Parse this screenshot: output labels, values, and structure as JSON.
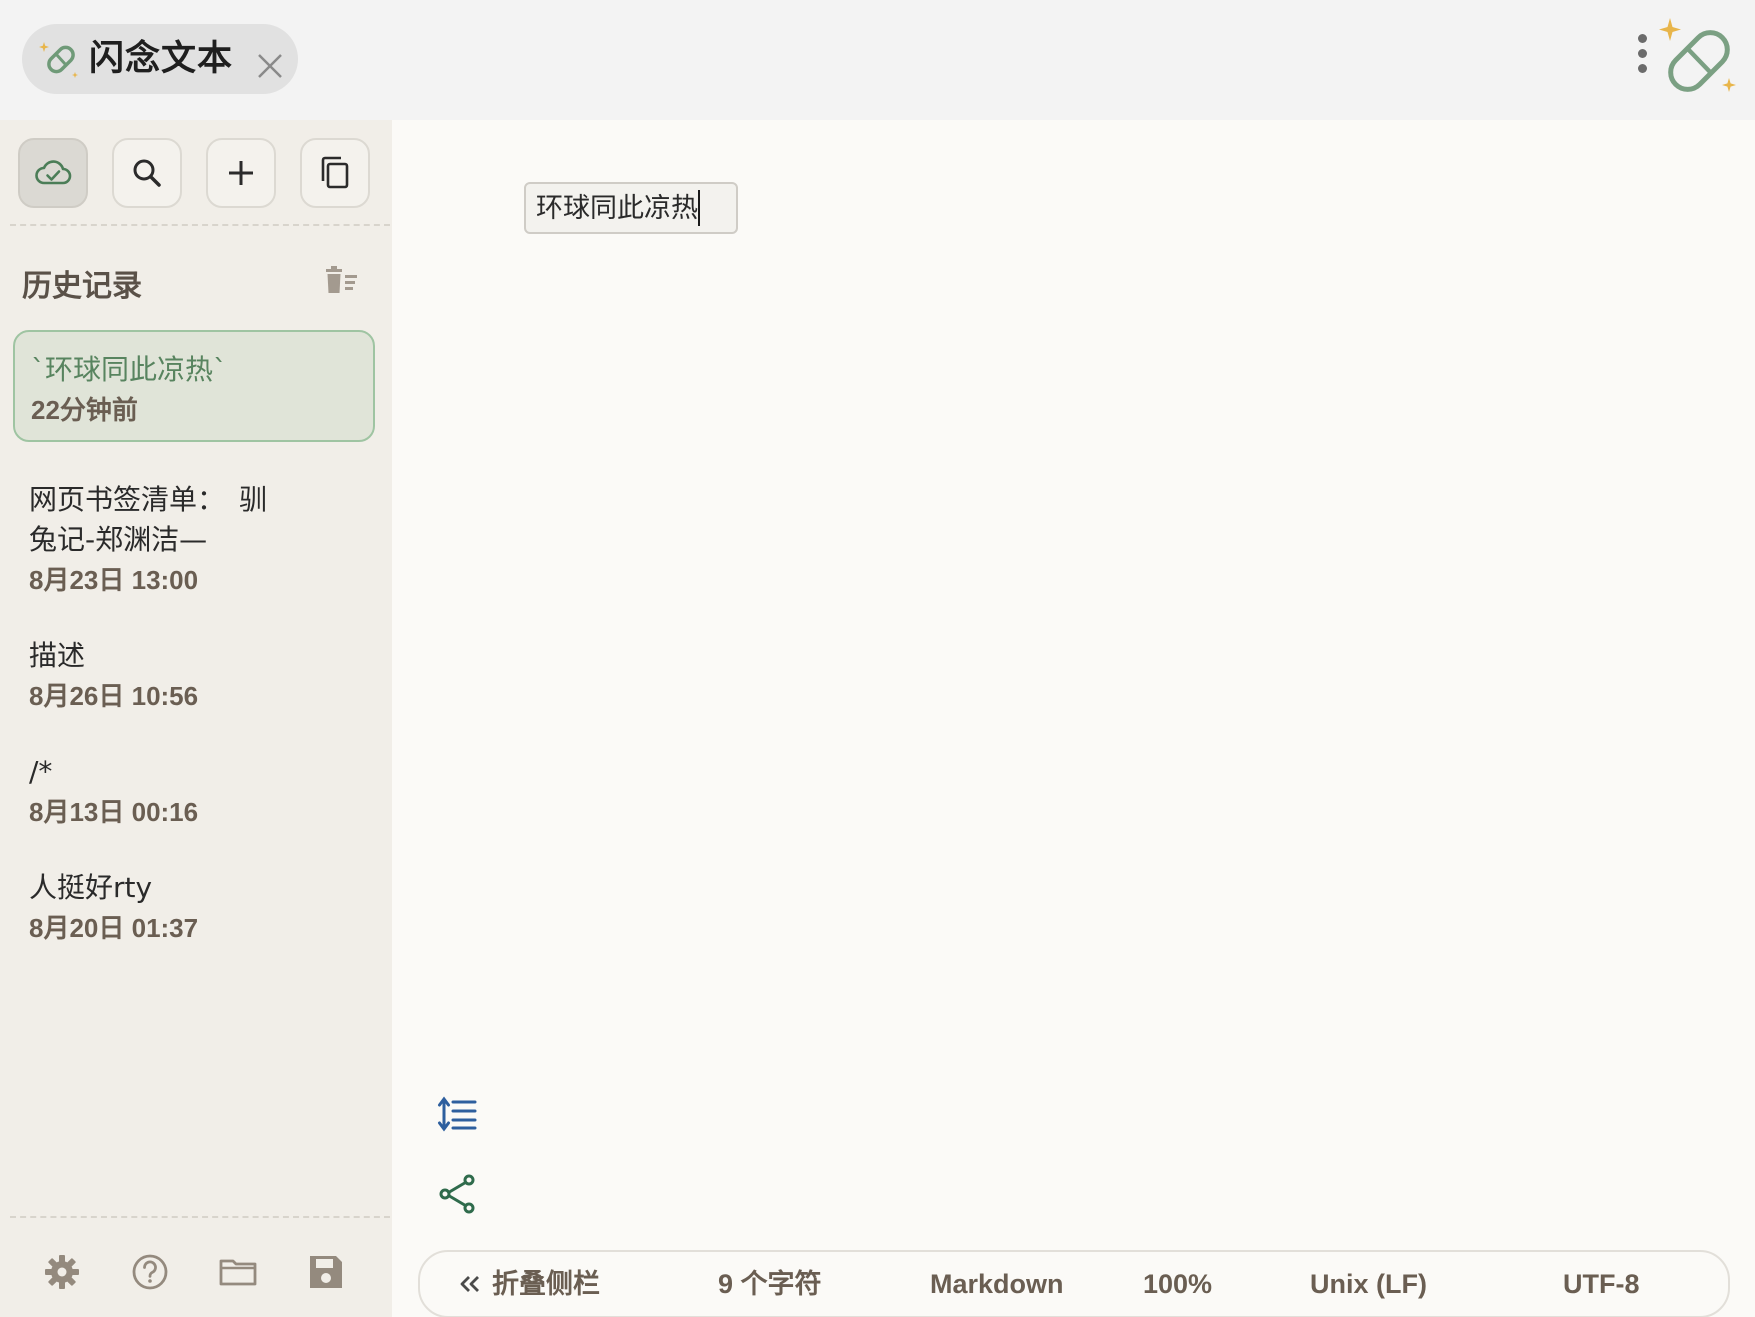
{
  "app": {
    "title": "闪念文本",
    "tab_logo_icon": "pill-sparkle-icon",
    "close_icon": "close-icon",
    "menu_icon": "more-vertical-icon",
    "corner_logo_icon": "pill-sparkle-logo-icon"
  },
  "toolbar": {
    "buttons": [
      {
        "name": "cloud-sync-icon",
        "active": true
      },
      {
        "name": "search-icon",
        "active": false
      },
      {
        "name": "plus-icon",
        "active": false
      },
      {
        "name": "copy-icon",
        "active": false
      }
    ]
  },
  "history": {
    "title": "历史记录",
    "clear_icon": "clear-history-icon",
    "items": [
      {
        "text": "`环球同此凉热`",
        "time": "22分钟前",
        "selected": true
      },
      {
        "text": "网页书签清单：　驯兔记-郑渊洁—",
        "time": "8月23日 13:00",
        "selected": false
      },
      {
        "text": "描述",
        "time": "8月26日 10:56",
        "selected": false
      },
      {
        "text": "/*",
        "time": "8月13日 00:16",
        "selected": false
      },
      {
        "text": "人挺好rty",
        "time": "8月20日 01:37",
        "selected": false
      }
    ]
  },
  "bottom_tools": [
    "settings-icon",
    "help-icon",
    "folder-icon",
    "save-icon"
  ],
  "editor": {
    "content": "环球同此凉热",
    "side_tools": [
      "line-height-icon",
      "share-icon"
    ]
  },
  "status": {
    "collapse_label": "折叠侧栏",
    "collapse_icon": "double-chevron-left-icon",
    "char_count": "9 个字符",
    "language": "Markdown",
    "zoom": "100%",
    "line_ending": "Unix (LF)",
    "encoding": "UTF-8"
  },
  "colors": {
    "accent_green": "#58845f",
    "selected_bg": "#e0e4d8",
    "selected_border": "#9fc4a2",
    "sparkle": "#e8b54a",
    "line_height_icon": "#2e5f9e",
    "share_icon": "#2f6b4c"
  }
}
